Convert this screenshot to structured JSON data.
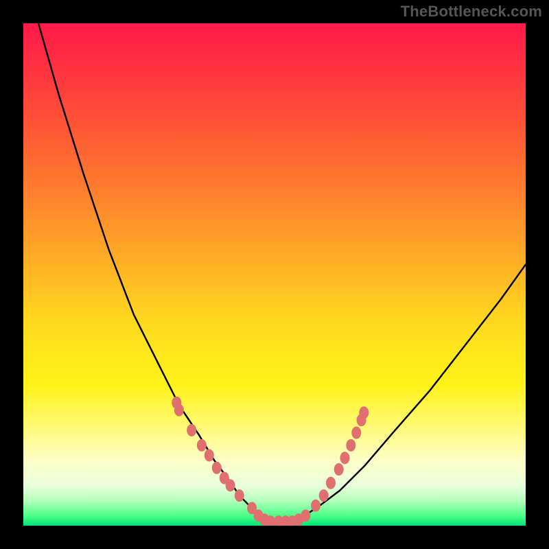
{
  "watermark": "TheBottleneck.com",
  "chart_data": {
    "type": "line",
    "title": "",
    "xlabel": "",
    "ylabel": "",
    "xlim": [
      0,
      1
    ],
    "ylim": [
      0,
      1
    ],
    "grid": false,
    "series": [
      {
        "name": "curve",
        "x": [
          0.03,
          0.07,
          0.12,
          0.17,
          0.22,
          0.27,
          0.31,
          0.35,
          0.38,
          0.41,
          0.43,
          0.45,
          0.47,
          0.5,
          0.53,
          0.56,
          0.59,
          0.63,
          0.68,
          0.74,
          0.81,
          0.88,
          0.95,
          1.0
        ],
        "y": [
          1.0,
          0.86,
          0.7,
          0.55,
          0.42,
          0.32,
          0.24,
          0.18,
          0.13,
          0.09,
          0.06,
          0.04,
          0.02,
          0.01,
          0.01,
          0.02,
          0.04,
          0.07,
          0.12,
          0.19,
          0.27,
          0.36,
          0.45,
          0.52
        ]
      }
    ],
    "markers": [
      {
        "x": 0.305,
        "y": 0.245
      },
      {
        "x": 0.31,
        "y": 0.23
      },
      {
        "x": 0.335,
        "y": 0.19
      },
      {
        "x": 0.355,
        "y": 0.16
      },
      {
        "x": 0.37,
        "y": 0.14
      },
      {
        "x": 0.385,
        "y": 0.115
      },
      {
        "x": 0.4,
        "y": 0.095
      },
      {
        "x": 0.412,
        "y": 0.08
      },
      {
        "x": 0.43,
        "y": 0.06
      },
      {
        "x": 0.455,
        "y": 0.035
      },
      {
        "x": 0.468,
        "y": 0.02
      },
      {
        "x": 0.48,
        "y": 0.012
      },
      {
        "x": 0.492,
        "y": 0.008
      },
      {
        "x": 0.508,
        "y": 0.008
      },
      {
        "x": 0.522,
        "y": 0.008
      },
      {
        "x": 0.535,
        "y": 0.008
      },
      {
        "x": 0.548,
        "y": 0.012
      },
      {
        "x": 0.562,
        "y": 0.02
      },
      {
        "x": 0.582,
        "y": 0.04
      },
      {
        "x": 0.598,
        "y": 0.06
      },
      {
        "x": 0.612,
        "y": 0.085
      },
      {
        "x": 0.628,
        "y": 0.112
      },
      {
        "x": 0.64,
        "y": 0.135
      },
      {
        "x": 0.652,
        "y": 0.16
      },
      {
        "x": 0.663,
        "y": 0.185
      },
      {
        "x": 0.673,
        "y": 0.21
      },
      {
        "x": 0.678,
        "y": 0.225
      }
    ],
    "marker_style": {
      "fill": "#e07070",
      "rx": 7,
      "ry": 9
    },
    "line_style": {
      "stroke": "#000000",
      "width": 2.5
    }
  }
}
